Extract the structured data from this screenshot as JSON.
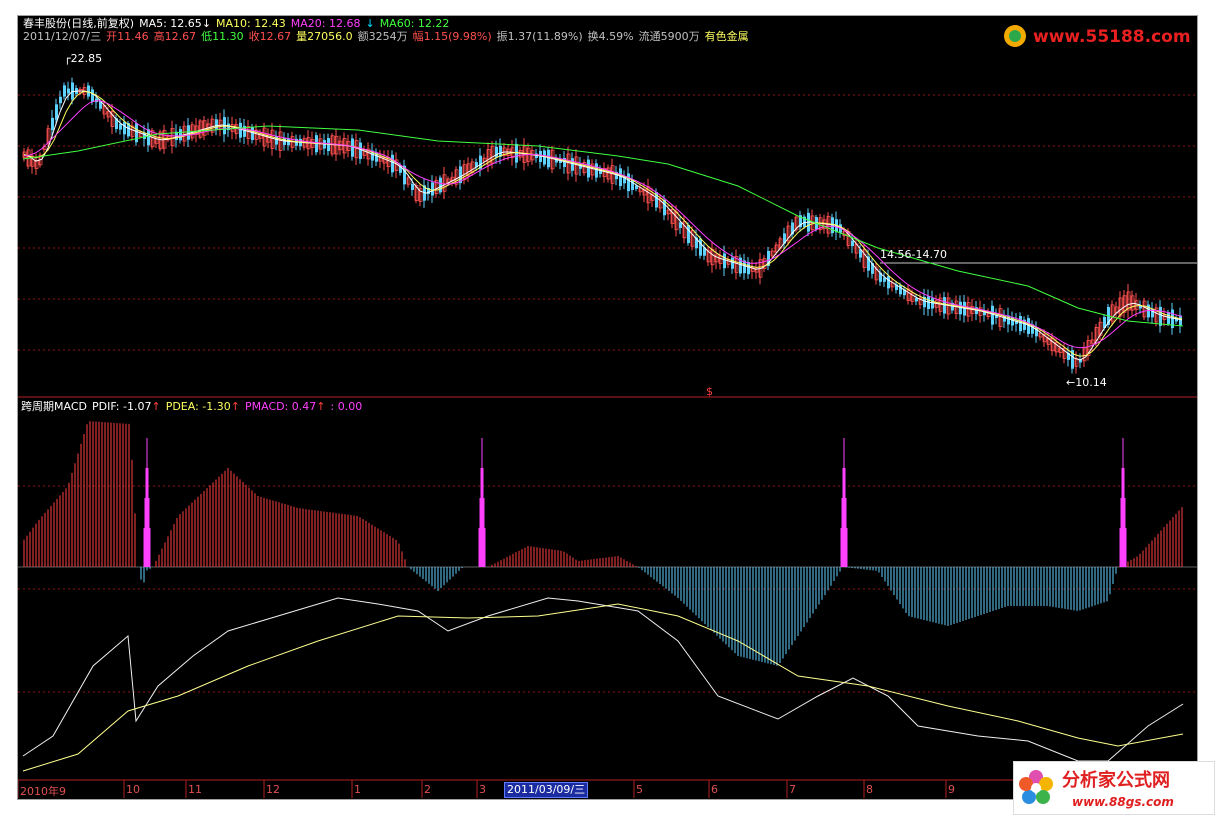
{
  "header": {
    "stock_name": "春丰股份(日线,前复权)",
    "ma5": "MA5: 12.65",
    "ma10": "MA10: 12.43",
    "ma20": "MA20: 12.68",
    "ma60": "MA60: 12.22",
    "date": "2011/12/07/三",
    "open": "开11.46",
    "high": "高12.67",
    "low": "低11.30",
    "close": "收12.67",
    "volume": "量27056.0",
    "amount": "额3254万",
    "change": "幅1.15(9.98%)",
    "amplitude": "振1.37(11.89%)",
    "turnover": "换4.59%",
    "float": "流通5900万",
    "sector": "有色金属"
  },
  "annotations": {
    "high_price": "22.85",
    "low_price": "10.14",
    "range": "14.56-14.70",
    "marker": "$"
  },
  "macd": {
    "name": "跨周期MACD",
    "pdif": "PDIF: -1.07",
    "pdea": "PDEA: -1.30",
    "pmacd": "PMACD: 0.47",
    "extra": ": 0.00"
  },
  "time_axis": {
    "selected_date": "2011/03/09/三",
    "labels": [
      "2010年9",
      "10",
      "11",
      "12",
      "1",
      "2",
      "3",
      "5",
      "6",
      "7",
      "8",
      "9"
    ]
  },
  "watermarks": {
    "top": "www.55188.com",
    "bottom_cn": "分析家公式网",
    "bottom_url": "www.88gs.com"
  },
  "colors": {
    "background": "#000000",
    "up": "#ff5050",
    "down": "#5fd3ff",
    "ma5": "#ffffff",
    "ma10": "#ffff60",
    "ma20": "#ff40ff",
    "ma60": "#40ff40",
    "macd_pos": "#ff4040",
    "macd_neg": "#60d0ff"
  }
}
